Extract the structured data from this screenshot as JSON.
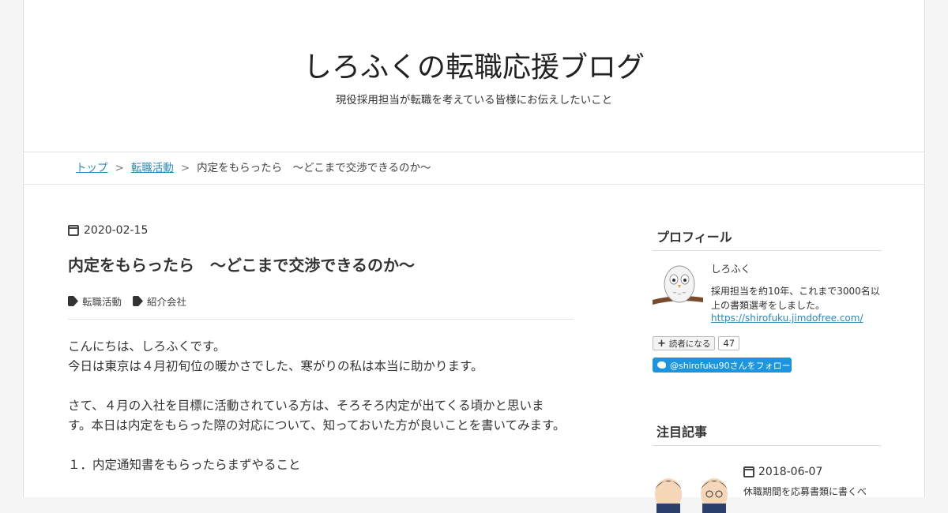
{
  "header": {
    "blog_title": "しろふくの転職応援ブログ",
    "blog_description": "現役採用担当が転職を考えている皆様にお伝えしたいこと"
  },
  "breadcrumb": {
    "items": [
      "トップ",
      "転職活動"
    ],
    "separator": ">",
    "current": "内定をもらったら　～どこまで交渉できるのか～"
  },
  "entry": {
    "date": "2020-02-15",
    "title": "内定をもらったら　～どこまで交渉できるのか～",
    "tags": [
      "転職活動",
      "紹介会社"
    ],
    "paragraphs": [
      [
        "こんにちは、しろふくです。",
        "今日は東京は４月初旬位の暖かさでした、寒がりの私は本当に助かります。"
      ],
      [
        "さて、４月の入社を目標に活動されている方は、そろそろ内定が出てくる頃かと思います。本日は内定をもらった際の対応について、知っておいた方が良いことを書いてみます。"
      ],
      [
        "１．内定通知書をもらったらまずやること"
      ]
    ]
  },
  "sidebar": {
    "profile": {
      "heading": "プロフィール",
      "name": "しろふく",
      "bio": "採用担当を約10年、これまで3000名以上の書類選考をしました。",
      "link": "https://shirofuku.jimdofree.com/",
      "subscribe_label": "読者になる",
      "subscriber_count": "47",
      "twitter_label": "@shirofuku90さんをフォロー"
    },
    "featured": {
      "heading": "注目記事",
      "date": "2018-06-07",
      "excerpt": "休職期間を応募書類に書くべ"
    }
  },
  "colors": {
    "link": "#2a8ab8",
    "twitter": "#1b95e0"
  }
}
